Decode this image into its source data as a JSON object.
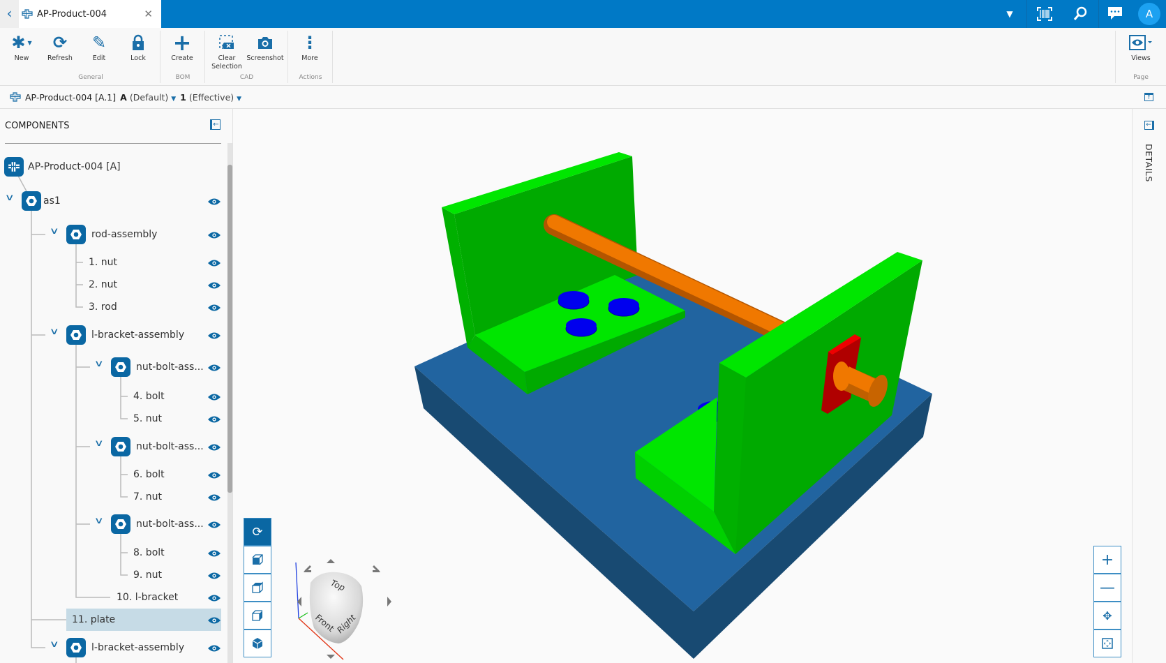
{
  "tab": {
    "title": "AP-Product-004"
  },
  "topbar": {
    "avatar": "A",
    "icons": [
      "chevron-down-icon",
      "barcode-scan-icon",
      "search-icon",
      "chat-icon"
    ]
  },
  "toolbar": {
    "buttons": [
      {
        "label": "New",
        "icon": "asterisk-icon"
      },
      {
        "label": "Refresh",
        "icon": "refresh-icon"
      },
      {
        "label": "Edit",
        "icon": "pencil-icon"
      },
      {
        "label": "Lock",
        "icon": "lock-icon"
      },
      {
        "label": "Create",
        "icon": "plus-icon"
      },
      {
        "label": "Clear",
        "label2": "Selection",
        "icon": "clear-selection-icon"
      },
      {
        "label": "Screenshot",
        "icon": "camera-icon"
      },
      {
        "label": "More",
        "icon": "more-vertical-icon"
      },
      {
        "label": "Views",
        "icon": "eye-icon"
      }
    ],
    "groups": [
      "General",
      "BOM",
      "CAD",
      "Actions",
      "Page"
    ]
  },
  "breadcrumb": {
    "item": "AP-Product-004 [A.1]",
    "rev": "A",
    "rev_note": "(Default)",
    "eff": "1",
    "eff_note": "(Effective)"
  },
  "panel": {
    "title": "COMPONENTS",
    "tree": [
      {
        "label": "AP-Product-004 [A]"
      },
      {
        "label": "as1"
      },
      {
        "label": "rod-assembly"
      },
      {
        "label": "1. nut"
      },
      {
        "label": "2. nut"
      },
      {
        "label": "3. rod"
      },
      {
        "label": "l-bracket-assembly"
      },
      {
        "label": "nut-bolt-ass..."
      },
      {
        "label": "4. bolt"
      },
      {
        "label": "5. nut"
      },
      {
        "label": "nut-bolt-ass..."
      },
      {
        "label": "6. bolt"
      },
      {
        "label": "7. nut"
      },
      {
        "label": "nut-bolt-ass..."
      },
      {
        "label": "8. bolt"
      },
      {
        "label": "9. nut"
      },
      {
        "label": "10. l-bracket"
      },
      {
        "label": "11. plate",
        "selected": true
      },
      {
        "label": "l-bracket-assembly"
      }
    ]
  },
  "details": {
    "title": "DETAILS"
  },
  "viewcube": {
    "top": "Top",
    "front": "Front",
    "right": "Right"
  },
  "colors": {
    "brand": "#0079c6",
    "plate": "#2164a0",
    "bracket": "#00e000",
    "bolt": "#0000ee",
    "rod": "#f07800",
    "washer": "#e00000"
  }
}
